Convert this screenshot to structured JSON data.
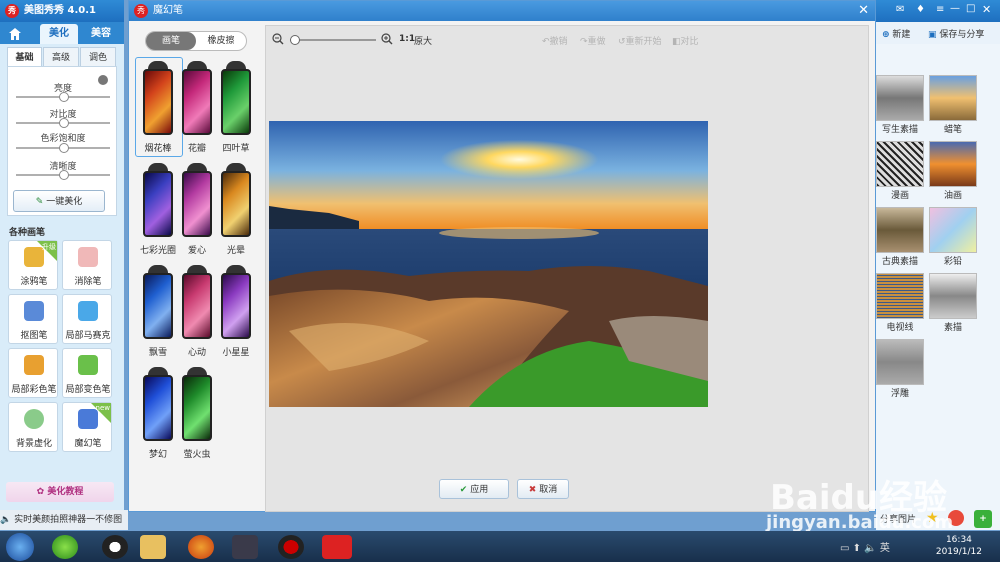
{
  "app": {
    "title": "美图秀秀 4.0.1",
    "logo": "秀"
  },
  "nav_tabs": [
    "美化",
    "美容"
  ],
  "sub_tabs": [
    "基础",
    "高级",
    "调色"
  ],
  "adjustments": [
    {
      "label": "亮度",
      "value": 0.5
    },
    {
      "label": "对比度",
      "value": 0.5
    },
    {
      "label": "色彩饱和度",
      "value": 0.5
    },
    {
      "label": "清晰度",
      "value": 0.5
    }
  ],
  "one_key_label": "一键美化",
  "brushes_heading": "各种画笔",
  "brushes": [
    {
      "label": "涂鸦笔",
      "badge": "升级"
    },
    {
      "label": "消除笔",
      "badge": ""
    },
    {
      "label": "抠图笔",
      "badge": ""
    },
    {
      "label": "局部马赛克",
      "badge": ""
    },
    {
      "label": "局部彩色笔",
      "badge": ""
    },
    {
      "label": "局部变色笔",
      "badge": ""
    },
    {
      "label": "背景虚化",
      "badge": ""
    },
    {
      "label": "魔幻笔",
      "badge": "new"
    }
  ],
  "tutorial_label": "美化教程",
  "status_text": "实时美颜拍照神器一不修图",
  "dialog": {
    "title": "魔幻笔",
    "mode_options": [
      "画笔",
      "橡皮擦"
    ],
    "zoom_label": "1:1",
    "zoom_text": "原大",
    "tools": [
      "撤销",
      "重做",
      "重新开始",
      "对比"
    ],
    "pens": [
      {
        "label": "烟花棒",
        "color": "#d2421b"
      },
      {
        "label": "花瓣",
        "color": "#c4287a"
      },
      {
        "label": "四叶草",
        "color": "#1f9a3a"
      },
      {
        "label": "七彩光圈",
        "color": "#3a3fc0"
      },
      {
        "label": "爱心",
        "color": "#b23aa0"
      },
      {
        "label": "光晕",
        "color": "#d9881f"
      },
      {
        "label": "飘雪",
        "color": "#1f5fd0"
      },
      {
        "label": "心动",
        "color": "#c83a70"
      },
      {
        "label": "小星星",
        "color": "#8a3ac0"
      },
      {
        "label": "梦幻",
        "color": "#1f4fd8"
      },
      {
        "label": "萤火虫",
        "color": "#1e8a2a"
      }
    ],
    "apply_label": "应用",
    "cancel_label": "取消"
  },
  "right_panel": {
    "new_label": "新建",
    "save_label": "保存与分享",
    "filters": [
      "写生素描",
      "蜡笔",
      "漫画",
      "油画",
      "古典素描",
      "彩铅",
      "电视线",
      "素描",
      "浮雕"
    ],
    "share_label": "分享图片"
  },
  "taskbar": {
    "time": "16:34",
    "date": "2019/1/12"
  },
  "watermark": {
    "brand": "Baidu经验",
    "url": "jingyan.baidu.com"
  }
}
